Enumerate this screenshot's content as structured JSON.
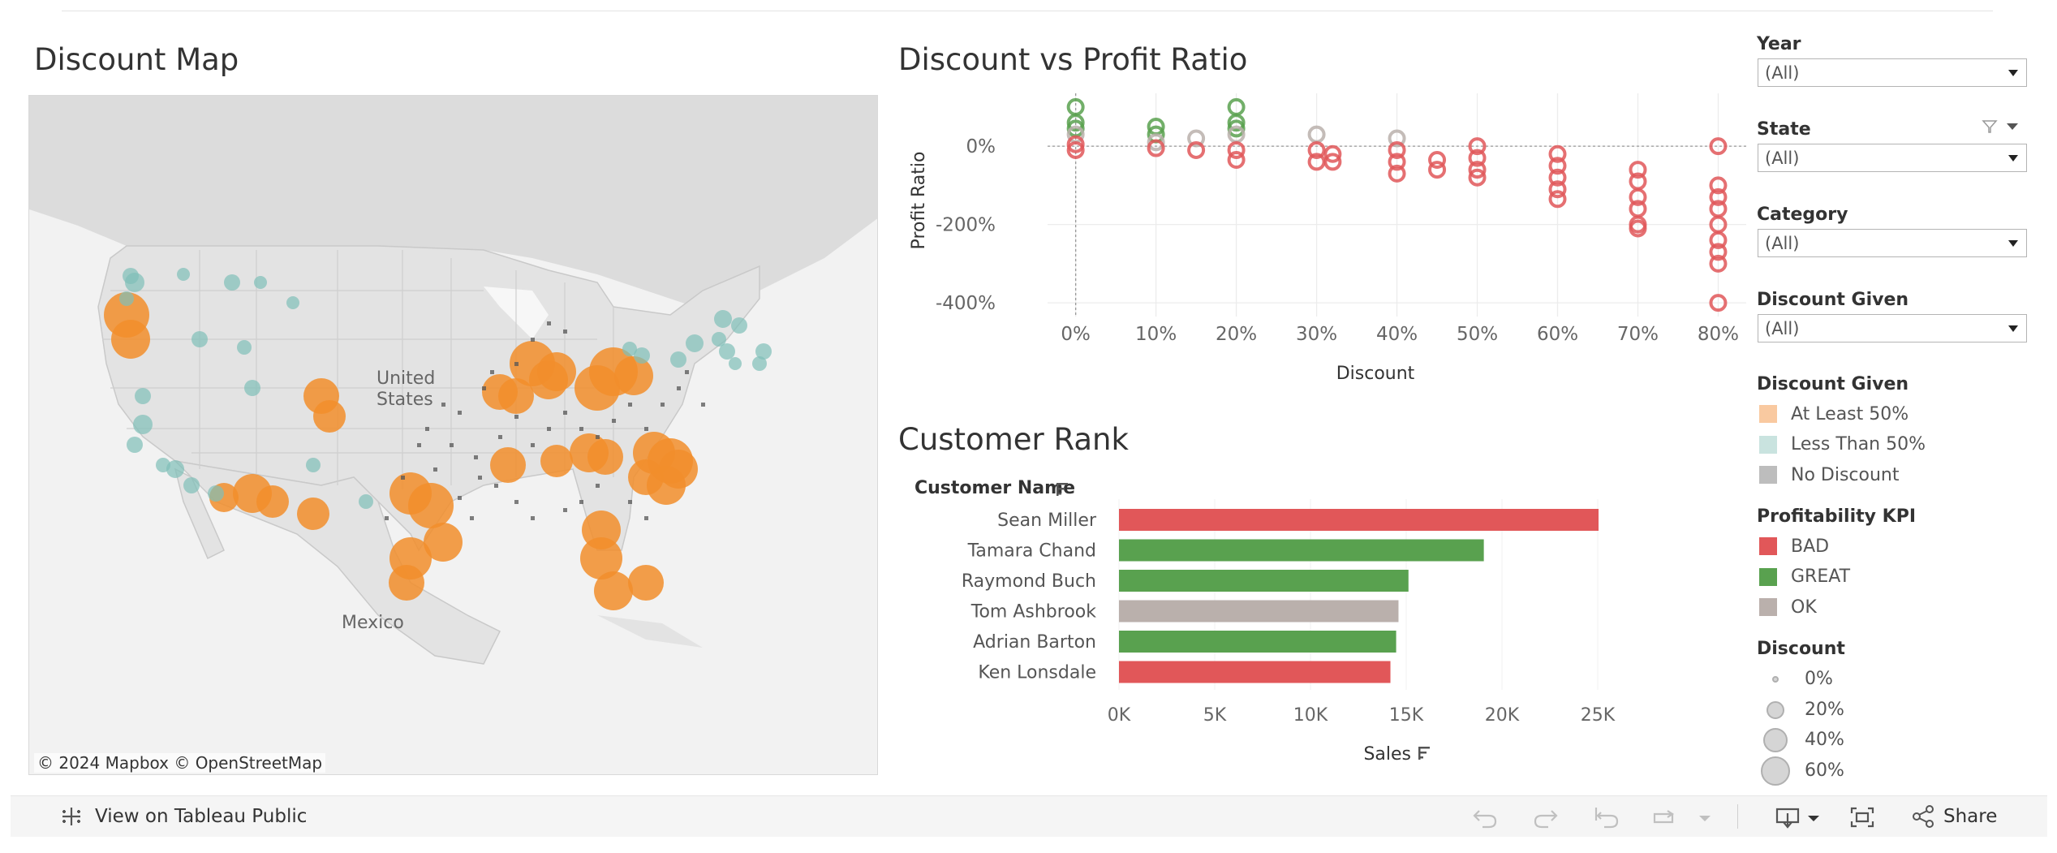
{
  "dashboard": {
    "map_title": "Discount Map",
    "scatter_title": "Discount vs Profit Ratio",
    "bar_title": "Customer Rank"
  },
  "map": {
    "labels": {
      "country_us": "United\nStates",
      "us_line1": "United",
      "us_line2": "States",
      "mexico": "Mexico"
    },
    "attribution": "© 2024 Mapbox  © OpenStreetMap",
    "colors": {
      "at_least_50": "#f28e2b",
      "less_than_50": "#7fbfb8",
      "no_discount": "#555555"
    }
  },
  "filters": [
    {
      "label": "Year",
      "value": "(All)"
    },
    {
      "label": "State",
      "value": "(All)"
    },
    {
      "label": "Category",
      "value": "(All)"
    },
    {
      "label": "Discount Given",
      "value": "(All)"
    }
  ],
  "legend_discount_given": {
    "title": "Discount Given",
    "items": [
      {
        "label": "At Least 50%",
        "color": "#f9c9a0"
      },
      {
        "label": "Less Than 50%",
        "color": "#c9e3df"
      },
      {
        "label": "No Discount",
        "color": "#bdbdbd"
      }
    ]
  },
  "legend_kpi": {
    "title": "Profitability KPI",
    "items": [
      {
        "label": "BAD",
        "color": "#e15759"
      },
      {
        "label": "GREAT",
        "color": "#59a14f"
      },
      {
        "label": "OK",
        "color": "#bab0ac"
      }
    ]
  },
  "legend_size": {
    "title": "Discount",
    "items": [
      "0%",
      "20%",
      "40%",
      "60%"
    ]
  },
  "chart_data": [
    {
      "type": "scatter",
      "title": "Discount vs Profit Ratio",
      "xlabel": "Discount",
      "ylabel": "Profit Ratio",
      "x_ticks": [
        "0%",
        "10%",
        "20%",
        "30%",
        "40%",
        "50%",
        "60%",
        "70%",
        "80%"
      ],
      "y_ticks": [
        "0%",
        "-200%",
        "-400%"
      ],
      "xlim": [
        0,
        0.85
      ],
      "ylim": [
        -4.5,
        1.0
      ],
      "series": [
        {
          "name": "GREAT",
          "color": "#59a14f",
          "points": [
            [
              0,
              1.0
            ],
            [
              0,
              0.6
            ],
            [
              0,
              0.45
            ],
            [
              0.1,
              0.5
            ],
            [
              0.1,
              0.3
            ],
            [
              0.2,
              1.0
            ],
            [
              0.2,
              0.6
            ],
            [
              0.2,
              0.45
            ]
          ]
        },
        {
          "name": "OK",
          "color": "#bab0ac",
          "points": [
            [
              0,
              0.3
            ],
            [
              0.1,
              0.1
            ],
            [
              0.15,
              0.2
            ],
            [
              0.2,
              0.3
            ],
            [
              0.3,
              0.3
            ],
            [
              0.4,
              0.2
            ]
          ]
        },
        {
          "name": "BAD",
          "color": "#e15759",
          "points": [
            [
              0,
              -0.1
            ],
            [
              0,
              0.05
            ],
            [
              0.1,
              -0.05
            ],
            [
              0.15,
              -0.1
            ],
            [
              0.2,
              -0.1
            ],
            [
              0.2,
              -0.35
            ],
            [
              0.3,
              -0.1
            ],
            [
              0.3,
              -0.4
            ],
            [
              0.32,
              -0.2
            ],
            [
              0.32,
              -0.4
            ],
            [
              0.4,
              -0.1
            ],
            [
              0.4,
              -0.4
            ],
            [
              0.4,
              -0.7
            ],
            [
              0.45,
              -0.35
            ],
            [
              0.45,
              -0.6
            ],
            [
              0.5,
              0.0
            ],
            [
              0.5,
              -0.3
            ],
            [
              0.5,
              -0.6
            ],
            [
              0.5,
              -0.8
            ],
            [
              0.6,
              -0.2
            ],
            [
              0.6,
              -0.5
            ],
            [
              0.6,
              -0.8
            ],
            [
              0.6,
              -1.1
            ],
            [
              0.6,
              -1.35
            ],
            [
              0.7,
              -0.6
            ],
            [
              0.7,
              -0.9
            ],
            [
              0.7,
              -1.3
            ],
            [
              0.7,
              -1.6
            ],
            [
              0.7,
              -2.0
            ],
            [
              0.7,
              -2.1
            ],
            [
              0.8,
              0.0
            ],
            [
              0.8,
              -1.0
            ],
            [
              0.8,
              -1.3
            ],
            [
              0.8,
              -1.6
            ],
            [
              0.8,
              -2.0
            ],
            [
              0.8,
              -2.4
            ],
            [
              0.8,
              -2.7
            ],
            [
              0.8,
              -3.0
            ],
            [
              0.8,
              -4.0
            ]
          ]
        }
      ]
    },
    {
      "type": "bar",
      "title": "Customer Rank",
      "ylabel": "Customer Name",
      "xlabel": "Sales",
      "x_ticks": [
        "0K",
        "5K",
        "10K",
        "15K",
        "20K",
        "25K"
      ],
      "xlim": [
        0,
        25000
      ],
      "categories": [
        "Sean Miller",
        "Tamara Chand",
        "Raymond Buch",
        "Tom Ashbrook",
        "Adrian Barton",
        "Ken Lonsdale"
      ],
      "values": [
        25043,
        19052,
        15117,
        14596,
        14474,
        14175
      ],
      "colors": [
        "#e15759",
        "#59a14f",
        "#59a14f",
        "#bab0ac",
        "#59a14f",
        "#e15759"
      ]
    }
  ],
  "toolbar": {
    "view_label": "View on Tableau Public",
    "share_label": "Share"
  }
}
